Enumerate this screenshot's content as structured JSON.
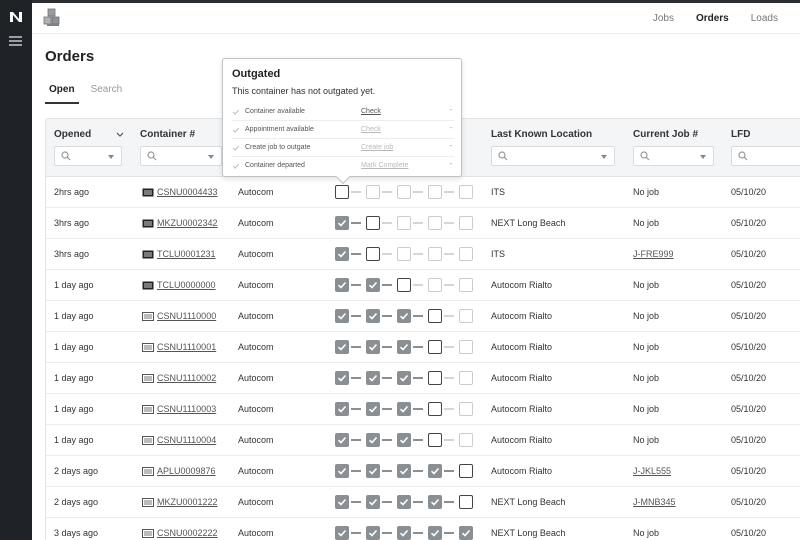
{
  "header": {
    "nav": [
      {
        "label": "Jobs",
        "active": false
      },
      {
        "label": "Orders",
        "active": true
      },
      {
        "label": "Loads",
        "active": false
      }
    ]
  },
  "page": {
    "title": "Orders",
    "tabs": [
      {
        "label": "Open",
        "active": true
      },
      {
        "label": "Search",
        "active": false
      }
    ]
  },
  "table": {
    "columns": [
      {
        "key": "opened",
        "label": "Opened",
        "sortable": true,
        "filter": true
      },
      {
        "key": "container",
        "label": "Container #",
        "filter": true
      },
      {
        "key": "customer",
        "label": "",
        "filter": false
      },
      {
        "key": "status",
        "label": "",
        "filter": false
      },
      {
        "key": "location",
        "label": "Last Known Location",
        "filter": true
      },
      {
        "key": "job",
        "label": "Current Job #",
        "filter": true
      },
      {
        "key": "lfd",
        "label": "LFD",
        "filter": true
      }
    ],
    "rows": [
      {
        "opened": "2hrs ago",
        "container": "CSNU0004433",
        "icon": "container-dark-icon",
        "customer": "Autocom",
        "steps": [
          "cur",
          "todo",
          "todo",
          "todo",
          "todo"
        ],
        "location": "ITS",
        "job": "No job",
        "job_link": false,
        "lfd": "05/10/20"
      },
      {
        "opened": "3hrs ago",
        "container": "MKZU0002342",
        "icon": "container-dark-icon",
        "customer": "Autocom",
        "steps": [
          "done",
          "cur",
          "todo",
          "todo",
          "todo"
        ],
        "location": "NEXT Long Beach",
        "job": "No job",
        "job_link": false,
        "lfd": "05/10/20"
      },
      {
        "opened": "3hrs ago",
        "container": "TCLU0001231",
        "icon": "container-dark-icon",
        "customer": "Autocom",
        "steps": [
          "done",
          "cur",
          "todo",
          "todo",
          "todo"
        ],
        "location": "ITS",
        "job": "J-FRE999",
        "job_link": true,
        "lfd": "05/10/20"
      },
      {
        "opened": "1 day ago",
        "container": "TCLU0000000",
        "icon": "container-dark-icon",
        "customer": "Autocom",
        "steps": [
          "done",
          "done",
          "cur",
          "todo",
          "todo"
        ],
        "location": "Autocom Rialto",
        "job": "No job",
        "job_link": false,
        "lfd": "05/10/20"
      },
      {
        "opened": "1 day ago",
        "container": "CSNU1110000",
        "icon": "container-outline-icon",
        "customer": "Autocom",
        "steps": [
          "done",
          "done",
          "done",
          "cur",
          "todo"
        ],
        "location": "Autocom Rialto",
        "job": "No job",
        "job_link": false,
        "lfd": "05/10/20"
      },
      {
        "opened": "1 day ago",
        "container": "CSNU1110001",
        "icon": "container-outline-icon",
        "customer": "Autocom",
        "steps": [
          "done",
          "done",
          "done",
          "cur",
          "todo"
        ],
        "location": "Autocom Rialto",
        "job": "No job",
        "job_link": false,
        "lfd": "05/10/20"
      },
      {
        "opened": "1 day ago",
        "container": "CSNU1110002",
        "icon": "container-outline-icon",
        "customer": "Autocom",
        "steps": [
          "done",
          "done",
          "done",
          "cur",
          "todo"
        ],
        "location": "Autocom Rialto",
        "job": "No job",
        "job_link": false,
        "lfd": "05/10/20"
      },
      {
        "opened": "1 day ago",
        "container": "CSNU1110003",
        "icon": "container-outline-icon",
        "customer": "Autocom",
        "steps": [
          "done",
          "done",
          "done",
          "cur",
          "todo"
        ],
        "location": "Autocom Rialto",
        "job": "No job",
        "job_link": false,
        "lfd": "05/10/20"
      },
      {
        "opened": "1 day ago",
        "container": "CSNU1110004",
        "icon": "container-outline-icon",
        "customer": "Autocom",
        "steps": [
          "done",
          "done",
          "done",
          "cur",
          "todo"
        ],
        "location": "Autocom Rialto",
        "job": "No job",
        "job_link": false,
        "lfd": "05/10/20"
      },
      {
        "opened": "2 days ago",
        "container": "APLU0009876",
        "icon": "container-outline-icon",
        "customer": "Autocom",
        "steps": [
          "done",
          "done",
          "done",
          "done",
          "cur"
        ],
        "location": "Autocom Rialto",
        "job": "J-JKL555",
        "job_link": true,
        "lfd": "05/10/20"
      },
      {
        "opened": "2 days ago",
        "container": "MKZU0001222",
        "icon": "container-outline-icon",
        "customer": "Autocom",
        "steps": [
          "done",
          "done",
          "done",
          "done",
          "cur"
        ],
        "location": "NEXT Long Beach",
        "job": "J-MNB345",
        "job_link": true,
        "lfd": "05/10/20"
      },
      {
        "opened": "3 days ago",
        "container": "CSNU0002222",
        "icon": "container-outline-icon",
        "customer": "Autocom",
        "steps": [
          "done",
          "done",
          "done",
          "done",
          "done"
        ],
        "location": "NEXT Long Beach",
        "job": "No job",
        "job_link": false,
        "lfd": "05/10/20"
      }
    ]
  },
  "popover": {
    "title": "Outgated",
    "message": "This container has not outgated yet.",
    "items": [
      {
        "label": "Container available",
        "action": "Check",
        "action_enabled": true,
        "value": "-"
      },
      {
        "label": "Appointment available",
        "action": "Check",
        "action_enabled": false,
        "value": "-"
      },
      {
        "label": "Create job to outgate",
        "action": "Create job",
        "action_enabled": false,
        "value": "-"
      },
      {
        "label": "Container departed",
        "action": "Mark Complete",
        "action_enabled": false,
        "value": "-"
      }
    ]
  },
  "colors": {
    "rail": "#1f2327",
    "step_done": "#8a8f94",
    "step_current_border": "#444444",
    "step_todo_border": "#c9cdd1",
    "header_bg": "#f4f5f6"
  }
}
